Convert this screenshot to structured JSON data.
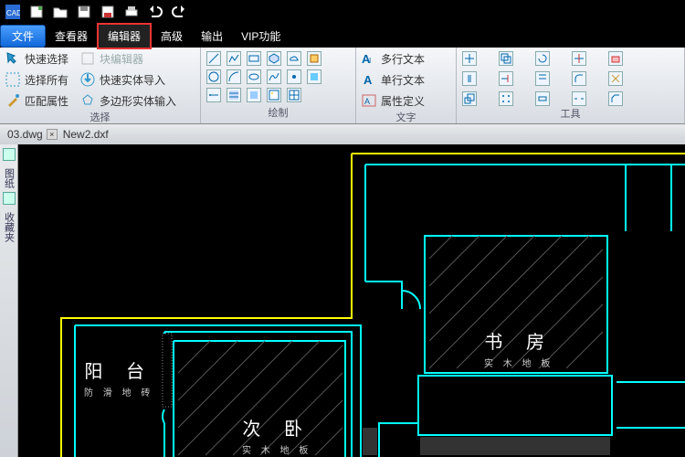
{
  "titlebar": {
    "app_icon": "CAD"
  },
  "menubar": {
    "file": "文件",
    "view": "查看器",
    "editor": "编辑器",
    "advanced": "高级",
    "output": "输出",
    "vip": "VIP功能"
  },
  "ribbon": {
    "select": {
      "quick_select": "快速选择",
      "block_editor": "块编辑器",
      "select_all": "选择所有",
      "quick_import": "快速实体导入",
      "match_props": "匹配属性",
      "polygon_import": "多边形实体输入",
      "group": "选择"
    },
    "draw": {
      "group": "绘制"
    },
    "text": {
      "multiline": "多行文本",
      "singleline": "单行文本",
      "attr": "属性定义",
      "group": "文字"
    },
    "tools": {
      "group": "工具"
    }
  },
  "tabs": {
    "t1": "03.dwg",
    "t2": "New2.dxf"
  },
  "sidebar": {
    "lbl1": "图纸",
    "lbl2": "收藏夹"
  },
  "rooms": {
    "balcony": {
      "name": "阳 台",
      "floor": "防 滑 地 砖"
    },
    "bedroom": {
      "name": "次 卧",
      "floor": "实 木 地 板"
    },
    "study": {
      "name": "书 房",
      "floor": "实 木 地 板"
    }
  }
}
